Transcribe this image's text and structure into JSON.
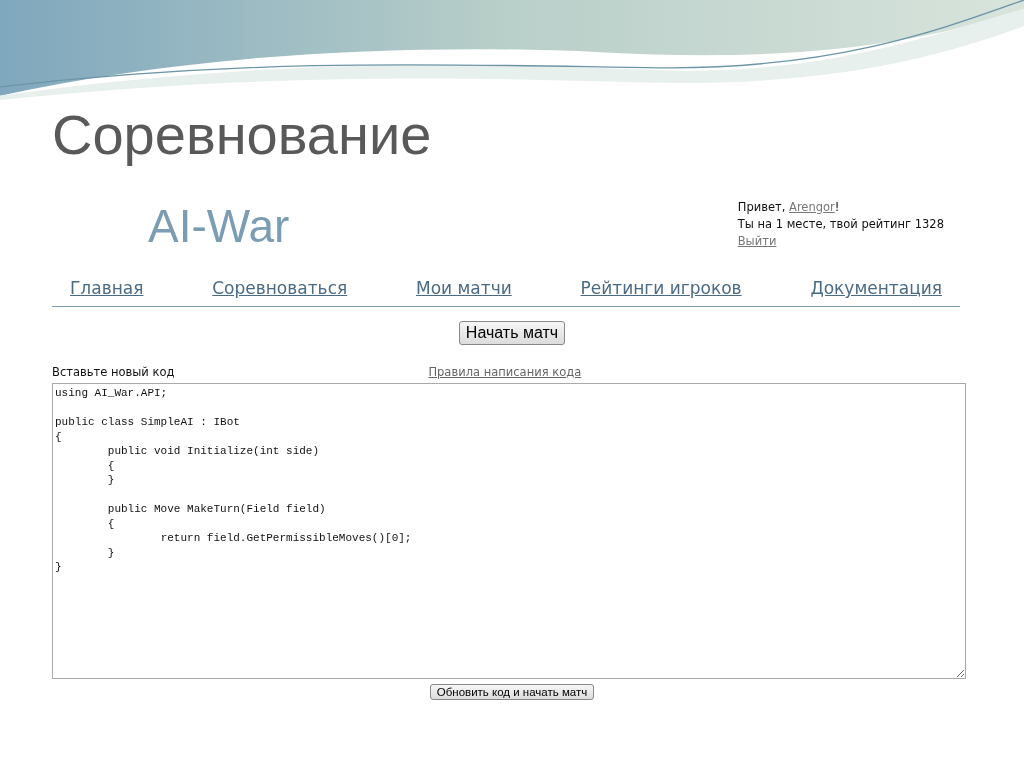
{
  "slide_title": "Соревнование",
  "site": {
    "logo": "AI-War"
  },
  "user_panel": {
    "greeting": "Привет, ",
    "username": "Arengor",
    "greeting_end": "!",
    "status": "Ты на 1 месте, твой рейтинг 1328",
    "logout": "Выйти"
  },
  "nav": [
    {
      "label": "Главная"
    },
    {
      "label": "Соревноваться"
    },
    {
      "label": "Мои матчи"
    },
    {
      "label": "Рейтинги игроков"
    },
    {
      "label": "Документация"
    }
  ],
  "start_button": "Начать матч",
  "code_form": {
    "label": "Вставьте новый код",
    "rules_link": "Правила написания кода",
    "code": "using AI_War.API;\n\npublic class SimpleAI : IBot\n{\n\tpublic void Initialize(int side)\n\t{\n\t}\n\n\tpublic Move MakeTurn(Field field)\n\t{\n\t\treturn field.GetPermissibleMoves()[0];\n\t}\n}",
    "submit_button": "Обновить код и начать матч"
  }
}
